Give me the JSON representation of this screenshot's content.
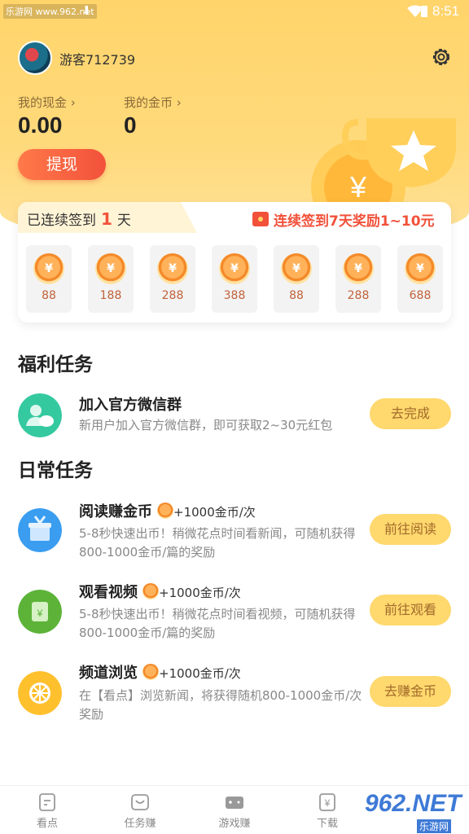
{
  "status_bar": {
    "site": "乐游网 www.962.net",
    "time": "8:51"
  },
  "user": {
    "name": "游客712739"
  },
  "wallet": {
    "cash_label": "我的现金 ›",
    "cash_value": "0.00",
    "coin_label": "我的金币 ›",
    "coin_value": "0",
    "withdraw_label": "提现"
  },
  "signin": {
    "prefix": "已连续签到",
    "days": "1",
    "suffix": "天",
    "reward_text": "连续签到7天奖励1~10元",
    "coin_symbol": "¥",
    "day_values": [
      "88",
      "188",
      "288",
      "388",
      "88",
      "288",
      "688"
    ]
  },
  "welfare": {
    "title": "福利任务",
    "task": {
      "title": "加入官方微信群",
      "desc": "新用户加入官方微信群，即可获取2~30元红包",
      "button": "去完成"
    }
  },
  "daily": {
    "title": "日常任务",
    "tasks": [
      {
        "title": "阅读赚金币",
        "plus": "+1000金币/次",
        "desc": "5-8秒快速出币！稍微花点时间看新闻，可随机获得800-1000金币/篇的奖励",
        "button": "前往阅读"
      },
      {
        "title": "观看视频",
        "plus": "+1000金币/次",
        "desc": "5-8秒快速出币！稍微花点时间看视频，可随机获得800-1000金币/篇的奖励",
        "button": "前往观看"
      },
      {
        "title": "频道浏览",
        "plus": "+1000金币/次",
        "desc": "在【看点】浏览新闻，将获得随机800-1000金币/次奖励",
        "button": "去赚金币"
      }
    ]
  },
  "nav": [
    {
      "label": "看点",
      "icon": "document-icon"
    },
    {
      "label": "任务赚",
      "icon": "task-icon"
    },
    {
      "label": "游戏赚",
      "icon": "gamepad-icon"
    },
    {
      "label": "下载",
      "icon": "yuan-icon"
    }
  ],
  "watermark": {
    "big": "962.NET",
    "small": "乐游网"
  },
  "colors": {
    "accent": "#ffd46a",
    "primary_red": "#f2513a",
    "button_yellow": "#ffd86e"
  }
}
